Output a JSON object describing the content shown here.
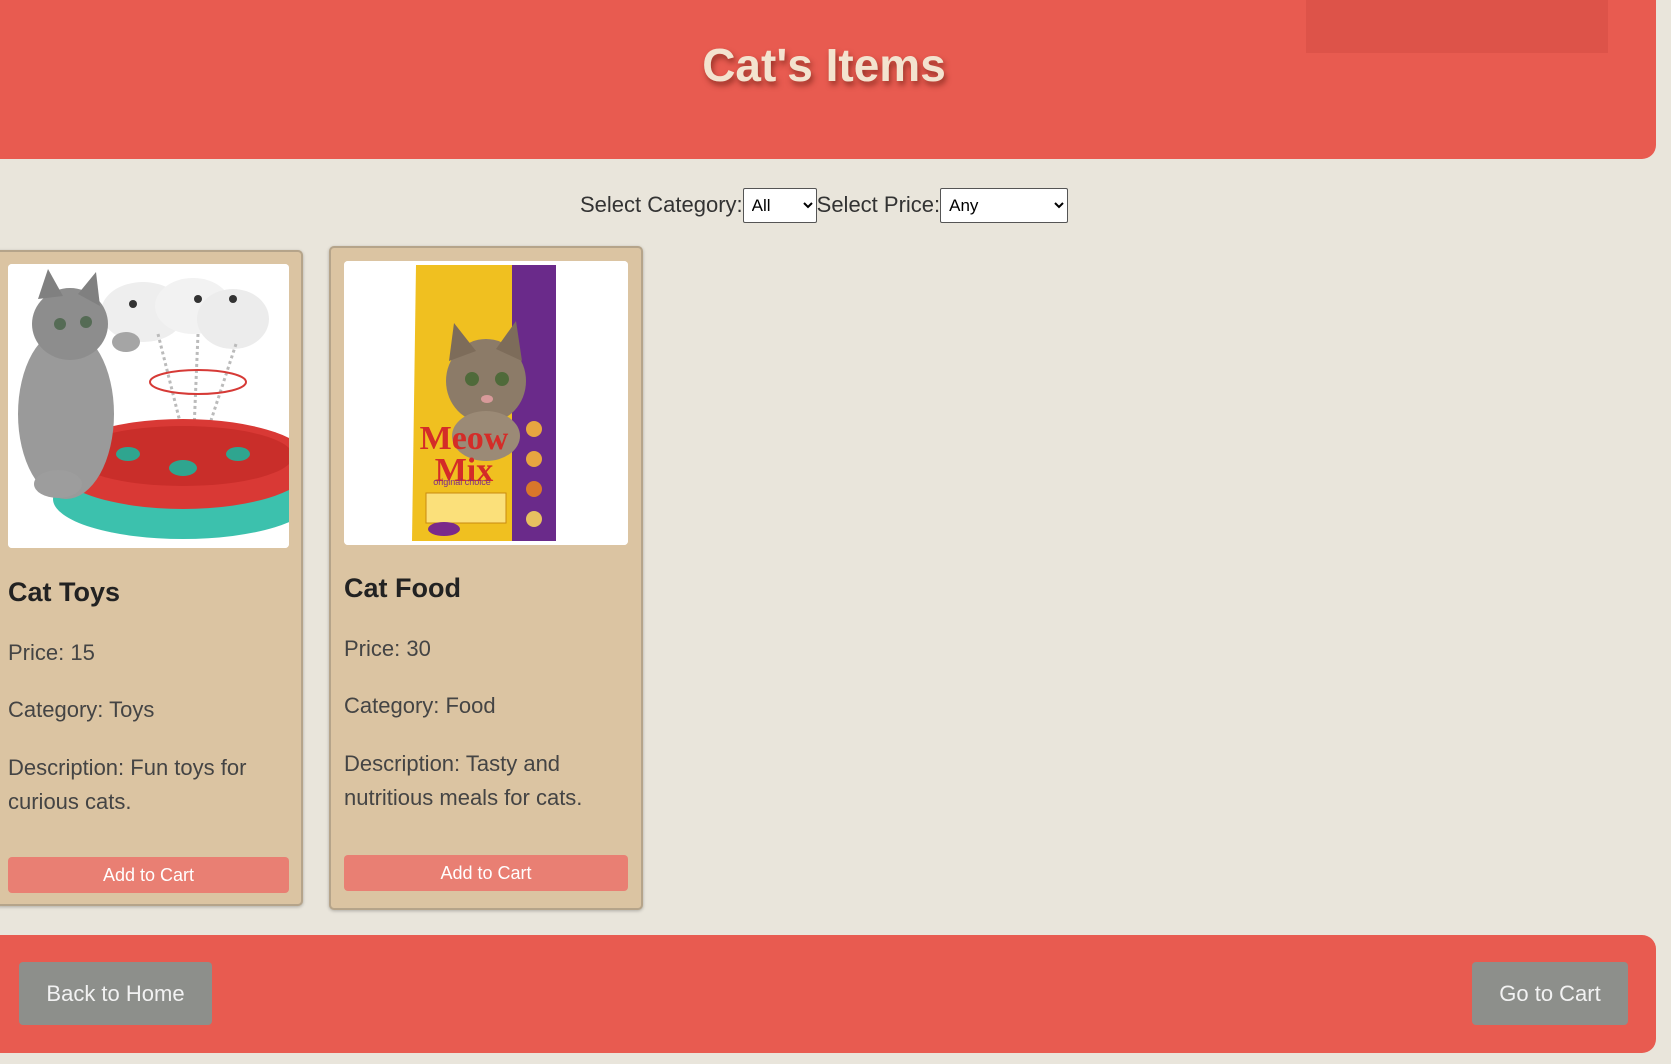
{
  "header": {
    "title": "Cat's Items"
  },
  "filters": {
    "category_label": "Select Category:",
    "category_value": "All",
    "price_label": "Select Price:",
    "price_value": "Any"
  },
  "products": [
    {
      "name": "Cat Toys",
      "price": "Price: 15",
      "category": "Category: Toys",
      "description": "Description: Fun toys for curious cats.",
      "button": "Add to Cart",
      "image": "cat-toy-image"
    },
    {
      "name": "Cat Food",
      "price": "Price: 30",
      "category": "Category: Food",
      "description": "Description: Tasty and nutritious meals for cats.",
      "button": "Add to Cart",
      "image": "cat-food-bag-image",
      "image_text": {
        "brand_line1": "Meow",
        "brand_line2": "Mix",
        "tagline": "original choice"
      }
    }
  ],
  "footer": {
    "back_label": "Back to Home",
    "cart_label": "Go to Cart"
  },
  "colors": {
    "header_bg": "#e85b50",
    "page_bg": "#e9e5db",
    "card_bg": "#dbc4a2",
    "add_button_bg": "#e97f73",
    "footer_button_bg": "#8d8f8b",
    "title_color": "#f3e3cf"
  }
}
